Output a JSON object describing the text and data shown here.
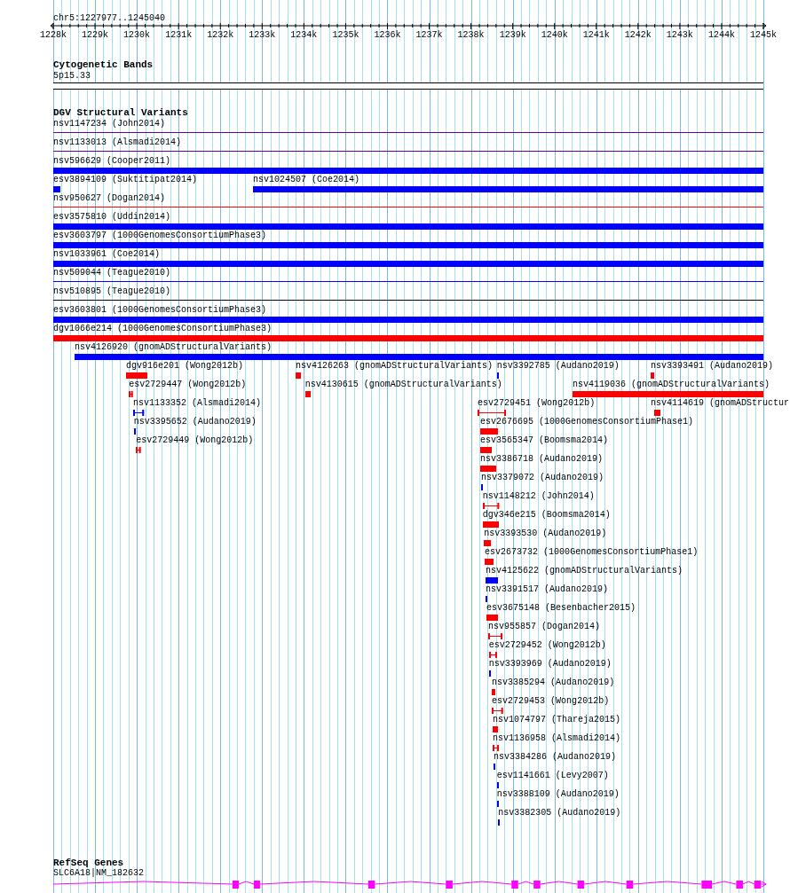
{
  "range": "chr5:1227977..1245040",
  "ruler": {
    "ticks": [
      "1228k",
      "1229k",
      "1230k",
      "1231k",
      "1232k",
      "1233k",
      "1234k",
      "1235k",
      "1236k",
      "1237k",
      "1238k",
      "1239k",
      "1240k",
      "1241k",
      "1242k",
      "1243k",
      "1244k",
      "1245k"
    ]
  },
  "cytogenetic_bands": {
    "title": "Cytogenetic Bands",
    "band": "5p15.33"
  },
  "dgv_structural_variants": {
    "title": "DGV Structural Variants",
    "rows": [
      [
        {
          "label": "nsv1147234 (John2014)",
          "kind": "line",
          "color": "#660099"
        }
      ],
      [
        {
          "label": "nsv1133013 (Alsmadi2014)",
          "kind": "line",
          "color": "#660099"
        }
      ],
      [
        {
          "label": "nsv596629 (Cooper2011)",
          "kind": "bar",
          "color": "#0000ff"
        }
      ],
      [
        {
          "label": "esv3894109 (Suktitipat2014)",
          "kind": "bar",
          "color": "#0000ff"
        },
        {
          "label": "nsv1024507 (Coe2014)",
          "kind": "bar",
          "color": "#0000ff"
        }
      ],
      [
        {
          "label": "nsv950627 (Dogan2014)",
          "kind": "line",
          "color": "#ff0000"
        }
      ],
      [
        {
          "label": "esv3575810 (Uddin2014)",
          "kind": "bar",
          "color": "#0000ff"
        }
      ],
      [
        {
          "label": "esv3603797 (1000GenomesConsortiumPhase3)",
          "kind": "bar",
          "color": "#0000ff"
        }
      ],
      [
        {
          "label": "nsv1033961 (Coe2014)",
          "kind": "bar",
          "color": "#0000ff"
        }
      ],
      [
        {
          "label": "nsv509044 (Teague2010)",
          "kind": "line",
          "color": "#0000ff"
        }
      ],
      [
        {
          "label": "nsv510895 (Teague2010)",
          "kind": "line",
          "color": "#000000"
        }
      ],
      [
        {
          "label": "esv3603801 (1000GenomesConsortiumPhase3)",
          "kind": "bar",
          "color": "#0000ff"
        }
      ],
      [
        {
          "label": "dgv1066e214 (1000GenomesConsortiumPhase3)",
          "kind": "bar",
          "color": "#ff0000"
        }
      ],
      [
        {
          "label": "nsv4126920 (gnomADStructuralVariants)",
          "kind": "bar",
          "color": "#0000ff"
        }
      ],
      [
        {
          "label": "dgv916e201 (Wong2012b)",
          "kind": "bar",
          "color": "#ff0000"
        },
        {
          "label": "nsv4126263 (gnomADStructuralVariants)",
          "kind": "bar",
          "color": "#ff0000"
        },
        {
          "label": "nsv3392785 (Audano2019)",
          "kind": "bar",
          "color": "#0000ff"
        },
        {
          "label": "nsv3393491 (Audano2019)",
          "kind": "bar",
          "color": "#ff0000"
        }
      ],
      [
        {
          "label": "esv2729447 (Wong2012b)",
          "kind": "bracket",
          "color": "#ff0000"
        },
        {
          "label": "nsv4130615 (gnomADStructuralVariants)",
          "kind": "bar",
          "color": "#ff0000"
        },
        {
          "label": "nsv4119036 (gnomADStructuralVariants)",
          "kind": "bar",
          "color": "#ff0000"
        }
      ],
      [
        {
          "label": "nsv1133352 (Alsmadi2014)",
          "kind": "bracket",
          "color": "#0000ff"
        },
        {
          "label": "esv2729451 (Wong2012b)",
          "kind": "bracket",
          "color": "#ff0000"
        },
        {
          "label": "nsv4114619 (gnomADStructur",
          "kind": "bar",
          "color": "#ff0000"
        }
      ],
      [
        {
          "label": "nsv3395652 (Audano2019)",
          "kind": "bar",
          "color": "#0000ff"
        },
        {
          "label": "esv2676695 (1000GenomesConsortiumPhase1)",
          "kind": "bar",
          "color": "#ff0000"
        }
      ],
      [
        {
          "label": "esv2729449 (Wong2012b)",
          "kind": "bracket",
          "color": "#ff0000"
        },
        {
          "label": "esv3565347 (Boomsma2014)",
          "kind": "bar",
          "color": "#ff0000"
        }
      ],
      [
        {
          "label": "nsv3386718 (Audano2019)",
          "kind": "bar",
          "color": "#ff0000"
        }
      ],
      [
        {
          "label": "nsv3379072 (Audano2019)",
          "kind": "bar",
          "color": "#0000ff"
        }
      ],
      [
        {
          "label": "nsv1148212 (John2014)",
          "kind": "bracket",
          "color": "#ff0000"
        }
      ],
      [
        {
          "label": "dgv346e215 (Boomsma2014)",
          "kind": "bar",
          "color": "#ff0000"
        }
      ],
      [
        {
          "label": "nsv3393530 (Audano2019)",
          "kind": "bar",
          "color": "#ff0000"
        }
      ],
      [
        {
          "label": "esv2673732 (1000GenomesConsortiumPhase1)",
          "kind": "bar",
          "color": "#ff0000"
        }
      ],
      [
        {
          "label": "nsv4125622 (gnomADStructuralVariants)",
          "kind": "bar",
          "color": "#0000ff"
        }
      ],
      [
        {
          "label": "nsv3391517 (Audano2019)",
          "kind": "bar",
          "color": "#0000ff"
        }
      ],
      [
        {
          "label": "esv3675148 (Besenbacher2015)",
          "kind": "bar",
          "color": "#ff0000"
        }
      ],
      [
        {
          "label": "nsv955857 (Dogan2014)",
          "kind": "bracket",
          "color": "#ff0000"
        }
      ],
      [
        {
          "label": "esv2729452 (Wong2012b)",
          "kind": "bracket",
          "color": "#ff0000"
        }
      ],
      [
        {
          "label": "nsv3393969 (Audano2019)",
          "kind": "bar",
          "color": "#0000ff"
        }
      ],
      [
        {
          "label": "nsv3385294 (Audano2019)",
          "kind": "bar",
          "color": "#ff0000"
        }
      ],
      [
        {
          "label": "esv2729453 (Wong2012b)",
          "kind": "bracket",
          "color": "#ff0000"
        }
      ],
      [
        {
          "label": "nsv1074797 (Thareja2015)",
          "kind": "bar",
          "color": "#ff0000"
        }
      ],
      [
        {
          "label": "nsv1136958 (Alsmadi2014)",
          "kind": "bracket",
          "color": "#ff0000"
        }
      ],
      [
        {
          "label": "nsv3384286 (Audano2019)",
          "kind": "bar",
          "color": "#0000ff"
        }
      ],
      [
        {
          "label": "esv1141661 (Levy2007)",
          "kind": "bar",
          "color": "#0000ff"
        }
      ],
      [
        {
          "label": "nsv3388109 (Audano2019)",
          "kind": "bar",
          "color": "#0000ff"
        }
      ],
      [
        {
          "label": "nsv3382305 (Audano2019)",
          "kind": "bar",
          "color": "#0000ff"
        }
      ]
    ]
  },
  "refseq_genes": {
    "title": "RefSeq Genes",
    "gene": {
      "label": "SLC6A18|NM_182632"
    }
  }
}
